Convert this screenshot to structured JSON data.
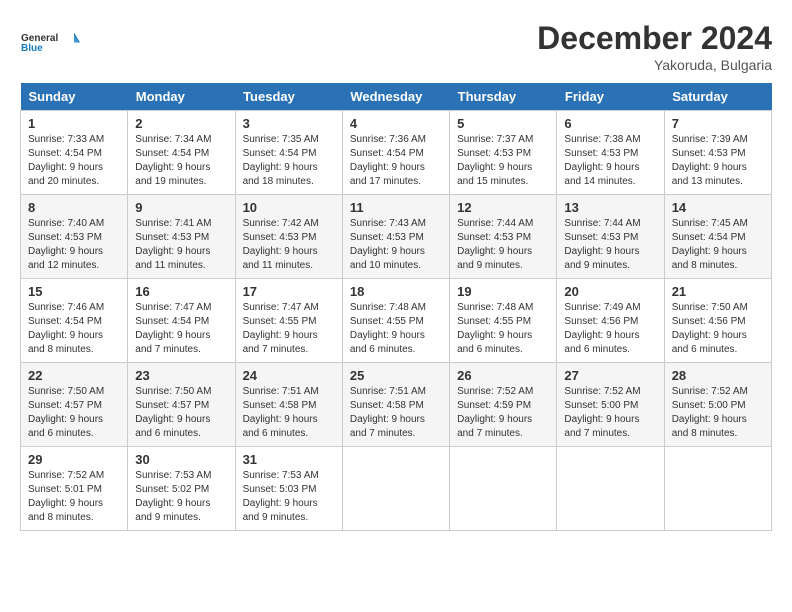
{
  "logo": {
    "line1": "General",
    "line2": "Blue"
  },
  "title": "December 2024",
  "location": "Yakoruda, Bulgaria",
  "days_of_week": [
    "Sunday",
    "Monday",
    "Tuesday",
    "Wednesday",
    "Thursday",
    "Friday",
    "Saturday"
  ],
  "weeks": [
    [
      {
        "day": "1",
        "sunrise": "7:33 AM",
        "sunset": "4:54 PM",
        "daylight": "9 hours and 20 minutes."
      },
      {
        "day": "2",
        "sunrise": "7:34 AM",
        "sunset": "4:54 PM",
        "daylight": "9 hours and 19 minutes."
      },
      {
        "day": "3",
        "sunrise": "7:35 AM",
        "sunset": "4:54 PM",
        "daylight": "9 hours and 18 minutes."
      },
      {
        "day": "4",
        "sunrise": "7:36 AM",
        "sunset": "4:54 PM",
        "daylight": "9 hours and 17 minutes."
      },
      {
        "day": "5",
        "sunrise": "7:37 AM",
        "sunset": "4:53 PM",
        "daylight": "9 hours and 15 minutes."
      },
      {
        "day": "6",
        "sunrise": "7:38 AM",
        "sunset": "4:53 PM",
        "daylight": "9 hours and 14 minutes."
      },
      {
        "day": "7",
        "sunrise": "7:39 AM",
        "sunset": "4:53 PM",
        "daylight": "9 hours and 13 minutes."
      }
    ],
    [
      {
        "day": "8",
        "sunrise": "7:40 AM",
        "sunset": "4:53 PM",
        "daylight": "9 hours and 12 minutes."
      },
      {
        "day": "9",
        "sunrise": "7:41 AM",
        "sunset": "4:53 PM",
        "daylight": "9 hours and 11 minutes."
      },
      {
        "day": "10",
        "sunrise": "7:42 AM",
        "sunset": "4:53 PM",
        "daylight": "9 hours and 11 minutes."
      },
      {
        "day": "11",
        "sunrise": "7:43 AM",
        "sunset": "4:53 PM",
        "daylight": "9 hours and 10 minutes."
      },
      {
        "day": "12",
        "sunrise": "7:44 AM",
        "sunset": "4:53 PM",
        "daylight": "9 hours and 9 minutes."
      },
      {
        "day": "13",
        "sunrise": "7:44 AM",
        "sunset": "4:53 PM",
        "daylight": "9 hours and 9 minutes."
      },
      {
        "day": "14",
        "sunrise": "7:45 AM",
        "sunset": "4:54 PM",
        "daylight": "9 hours and 8 minutes."
      }
    ],
    [
      {
        "day": "15",
        "sunrise": "7:46 AM",
        "sunset": "4:54 PM",
        "daylight": "9 hours and 8 minutes."
      },
      {
        "day": "16",
        "sunrise": "7:47 AM",
        "sunset": "4:54 PM",
        "daylight": "9 hours and 7 minutes."
      },
      {
        "day": "17",
        "sunrise": "7:47 AM",
        "sunset": "4:55 PM",
        "daylight": "9 hours and 7 minutes."
      },
      {
        "day": "18",
        "sunrise": "7:48 AM",
        "sunset": "4:55 PM",
        "daylight": "9 hours and 6 minutes."
      },
      {
        "day": "19",
        "sunrise": "7:48 AM",
        "sunset": "4:55 PM",
        "daylight": "9 hours and 6 minutes."
      },
      {
        "day": "20",
        "sunrise": "7:49 AM",
        "sunset": "4:56 PM",
        "daylight": "9 hours and 6 minutes."
      },
      {
        "day": "21",
        "sunrise": "7:50 AM",
        "sunset": "4:56 PM",
        "daylight": "9 hours and 6 minutes."
      }
    ],
    [
      {
        "day": "22",
        "sunrise": "7:50 AM",
        "sunset": "4:57 PM",
        "daylight": "9 hours and 6 minutes."
      },
      {
        "day": "23",
        "sunrise": "7:50 AM",
        "sunset": "4:57 PM",
        "daylight": "9 hours and 6 minutes."
      },
      {
        "day": "24",
        "sunrise": "7:51 AM",
        "sunset": "4:58 PM",
        "daylight": "9 hours and 6 minutes."
      },
      {
        "day": "25",
        "sunrise": "7:51 AM",
        "sunset": "4:58 PM",
        "daylight": "9 hours and 7 minutes."
      },
      {
        "day": "26",
        "sunrise": "7:52 AM",
        "sunset": "4:59 PM",
        "daylight": "9 hours and 7 minutes."
      },
      {
        "day": "27",
        "sunrise": "7:52 AM",
        "sunset": "5:00 PM",
        "daylight": "9 hours and 7 minutes."
      },
      {
        "day": "28",
        "sunrise": "7:52 AM",
        "sunset": "5:00 PM",
        "daylight": "9 hours and 8 minutes."
      }
    ],
    [
      {
        "day": "29",
        "sunrise": "7:52 AM",
        "sunset": "5:01 PM",
        "daylight": "9 hours and 8 minutes."
      },
      {
        "day": "30",
        "sunrise": "7:53 AM",
        "sunset": "5:02 PM",
        "daylight": "9 hours and 9 minutes."
      },
      {
        "day": "31",
        "sunrise": "7:53 AM",
        "sunset": "5:03 PM",
        "daylight": "9 hours and 9 minutes."
      },
      null,
      null,
      null,
      null
    ]
  ],
  "labels": {
    "sunrise": "Sunrise:",
    "sunset": "Sunset:",
    "daylight": "Daylight:"
  }
}
